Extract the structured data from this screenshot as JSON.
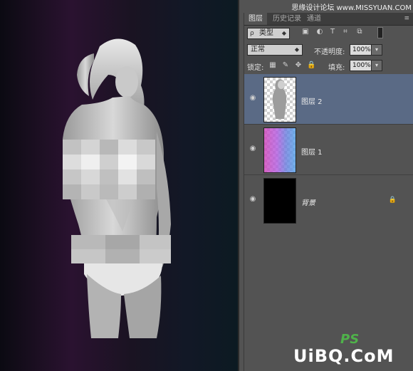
{
  "watermark": {
    "top": "思缘设计论坛 www.MISSYUAN.COM",
    "ps_mark": "PS",
    "site": "UiBQ.CoM"
  },
  "panel": {
    "tabs": [
      {
        "label": "图层"
      },
      {
        "label": "历史记录"
      },
      {
        "label": "通道"
      }
    ],
    "filter": {
      "prefix": "ρ",
      "kind_label": "类型"
    },
    "blend_mode": "正常",
    "opacity_label": "不透明度:",
    "opacity_value": "100%",
    "lock_label": "锁定:",
    "fill_label": "填充:",
    "fill_value": "100%",
    "layers": [
      {
        "name": "图层 2",
        "selected": true
      },
      {
        "name": "图层 1",
        "selected": false
      },
      {
        "name": "背景",
        "selected": false
      }
    ]
  },
  "colors": {
    "selected_layer": "#5a6a85",
    "panel_bg": "#535353"
  },
  "icons": [
    "eye-icon",
    "lock-icon",
    "image-filter-icon",
    "text-filter-icon",
    "shape-filter-icon",
    "smart-object-filter-icon",
    "brush-icon",
    "move-icon"
  ]
}
